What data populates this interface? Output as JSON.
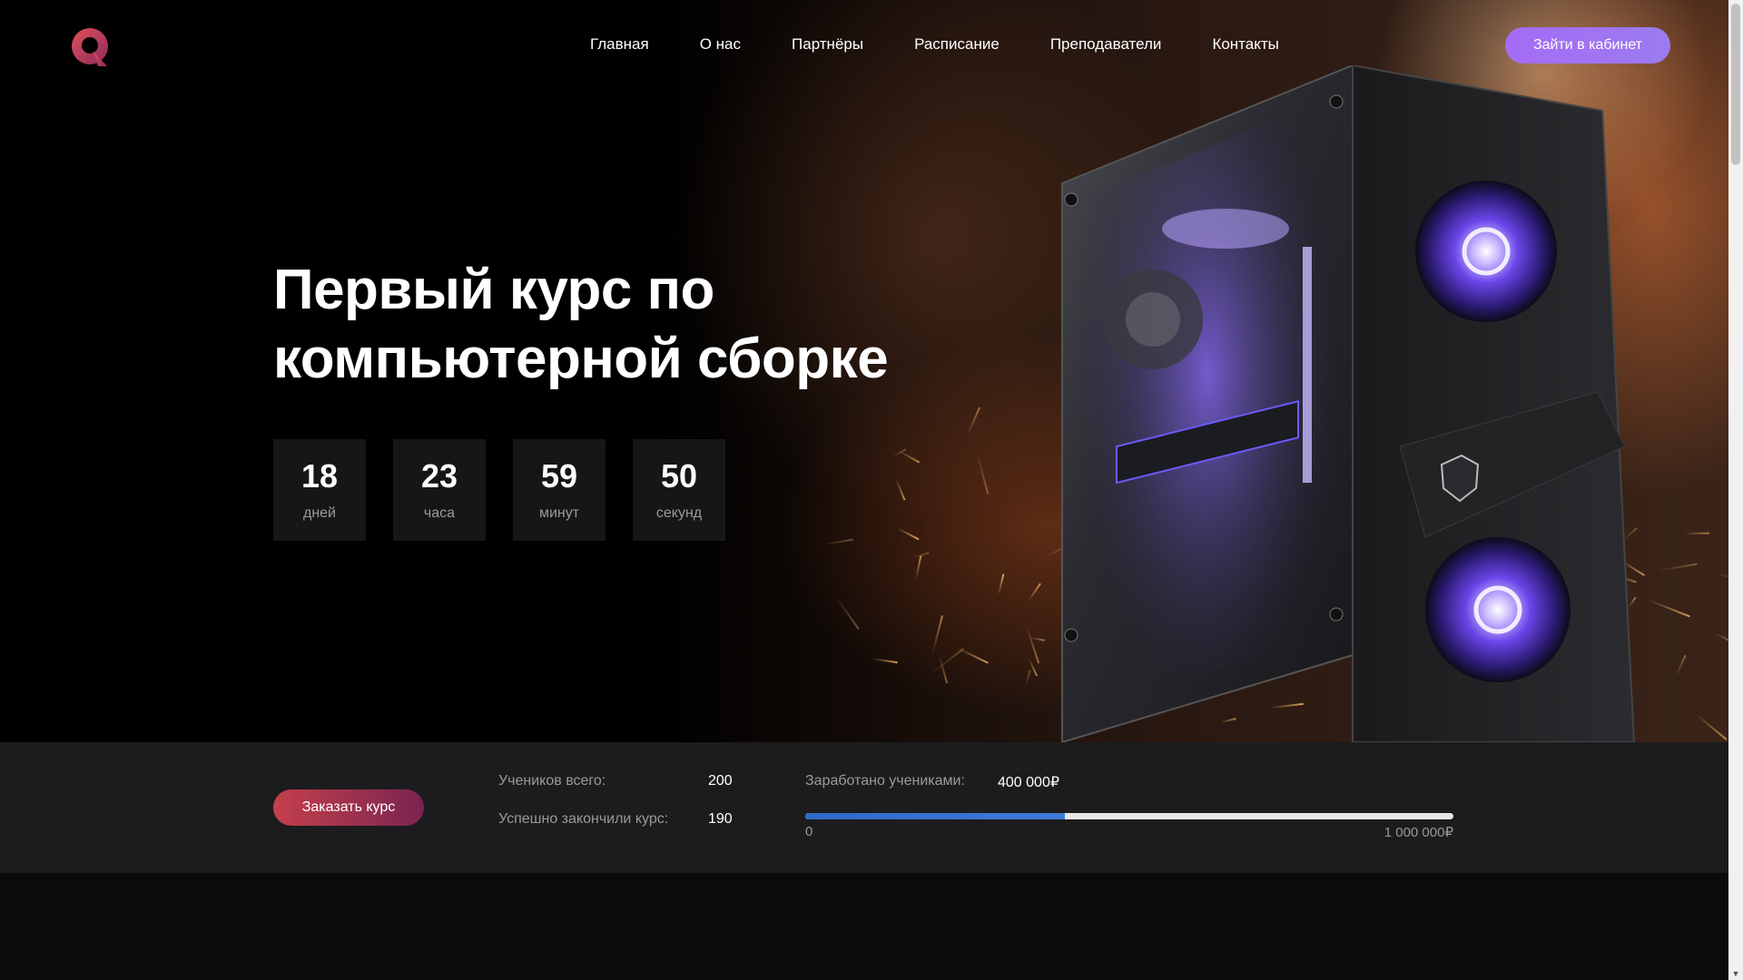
{
  "nav": {
    "items": [
      "Главная",
      "О нас",
      "Партнёры",
      "Расписание",
      "Преподаватели",
      "Контакты"
    ],
    "login_label": "Зайти в кабинет"
  },
  "hero": {
    "title_line1": "Первый курс по",
    "title_line2": "компьютерной сборке"
  },
  "countdown": [
    {
      "value": "18",
      "label": "дней"
    },
    {
      "value": "23",
      "label": "часа"
    },
    {
      "value": "59",
      "label": "минут"
    },
    {
      "value": "50",
      "label": "секунд"
    }
  ],
  "stats": {
    "order_label": "Заказать курс",
    "students_total_label": "Учеников всего:",
    "students_total_value": "200",
    "completed_label": "Успешно закончили курс:",
    "completed_value": "190",
    "earned_label": "Заработано учениками:",
    "earned_value": "400 000₽",
    "progress_min": "0",
    "progress_max": "1 000 000₽",
    "progress_fraction": 0.4
  },
  "colors": {
    "accent_purple": "#a56cf5",
    "accent_red": "#c4404b",
    "progress_blue": "#2d6ac7",
    "stats_bg": "#1c1c1e"
  },
  "icons": {
    "logo": "brand-logo-icon",
    "scroll_up": "chevron-up-icon",
    "scroll_down": "chevron-down-icon"
  }
}
